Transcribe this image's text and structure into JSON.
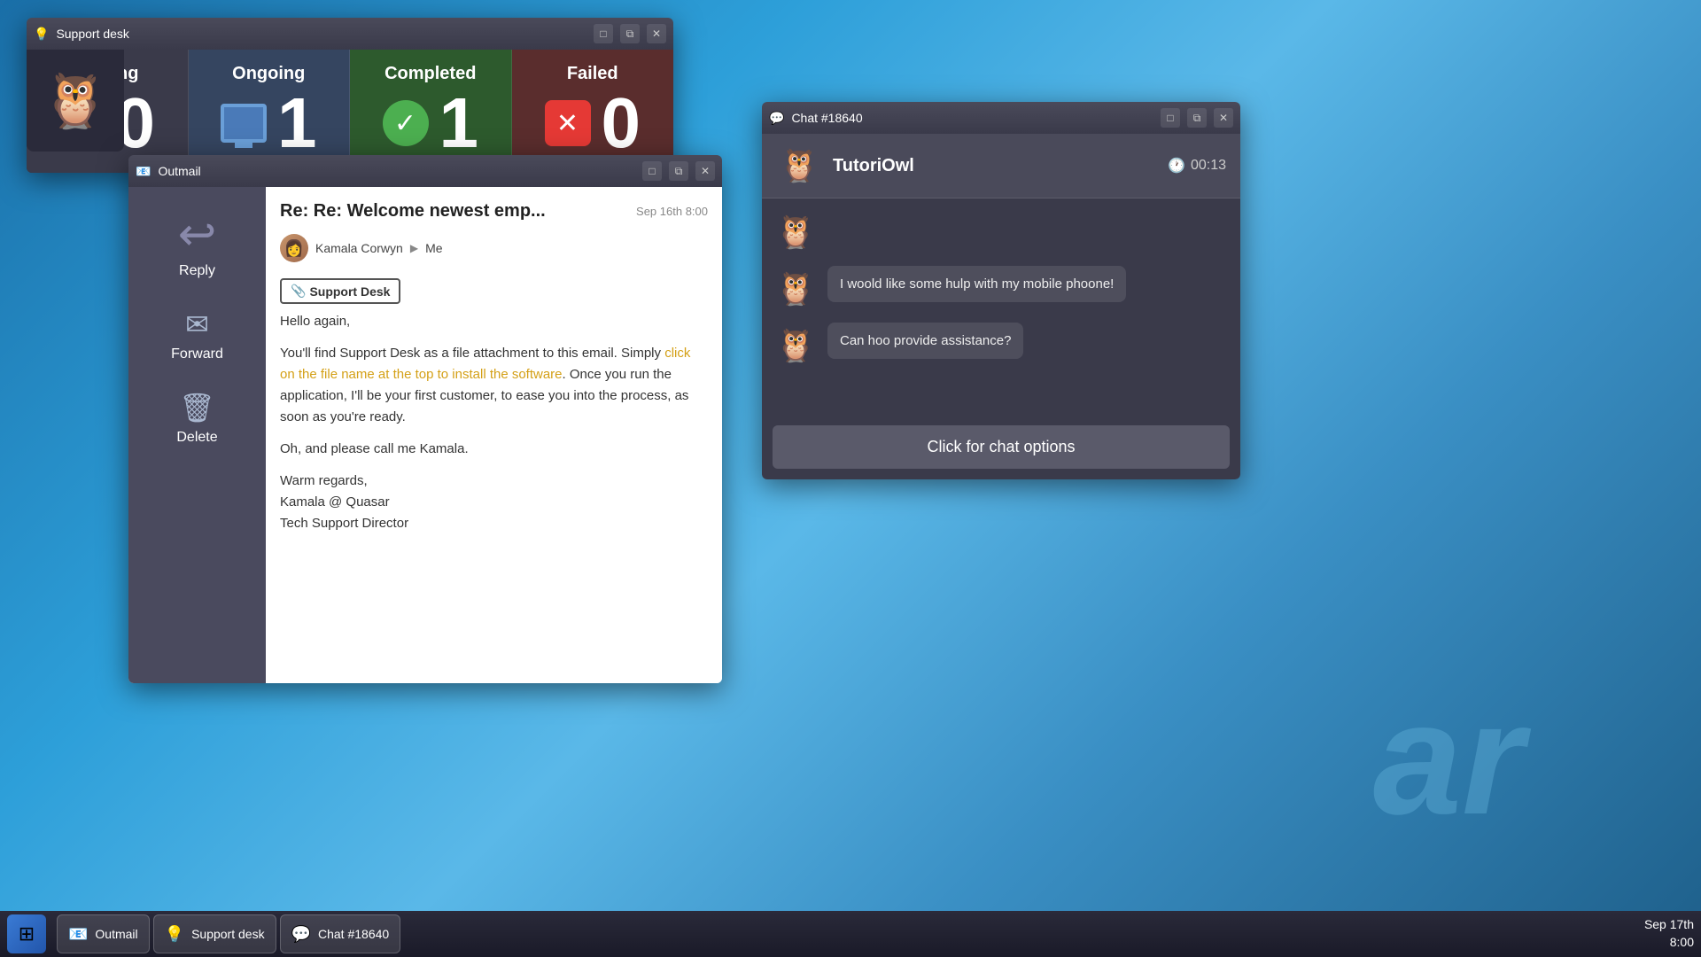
{
  "desktop": {
    "watermark": "ar"
  },
  "support_window": {
    "title": "Support desk",
    "icon": "💡",
    "stats": [
      {
        "label": "Waiting",
        "count": "0",
        "icon_type": "wifi",
        "bg": "waiting"
      },
      {
        "label": "Ongoing",
        "count": "1",
        "icon_type": "monitor",
        "bg": "ongoing"
      },
      {
        "label": "Completed",
        "count": "1",
        "icon_type": "check",
        "bg": "completed"
      },
      {
        "label": "Failed",
        "count": "0",
        "icon_type": "x",
        "bg": "failed"
      }
    ]
  },
  "outmail_window": {
    "title": "Outmail",
    "icon": "✉️",
    "actions": [
      {
        "label": "Reply",
        "icon": "↩"
      },
      {
        "label": "Forward",
        "icon": "✉"
      },
      {
        "label": "Delete",
        "icon": "🗑"
      }
    ],
    "email": {
      "subject": "Re: Re: Welcome newest emp...",
      "date": "Sep 16th 8:00",
      "from": "Kamala Corwyn",
      "to": "Me",
      "attachment": "Support Desk",
      "body_greeting": "Hello again,",
      "body_p1_normal_start": "You'll find Support Desk as a file attachment to this email. Simply ",
      "body_p1_highlight": "click on the file name at the top to install the software",
      "body_p1_normal_end": ". Once you run the application, I'll be your first customer, to ease you into the process, as soon as you're ready.",
      "body_p2": "Oh, and please call me Kamala.",
      "body_closing": "Warm regards,",
      "body_sig1": "Kamala @ Quasar",
      "body_sig2": "Tech Support Director"
    }
  },
  "chat_window": {
    "title": "Chat #18640",
    "icon": "💬",
    "username": "TutoriOwl",
    "timer": "00:13",
    "messages": [
      {
        "text": "I woold like some hulp with my mobile phoone!"
      },
      {
        "text": "Can hoo provide assistance?"
      }
    ],
    "options_button": "Click for chat options"
  },
  "taskbar": {
    "start_icon": "⊞",
    "items": [
      {
        "label": "Outmail",
        "icon": "📧"
      },
      {
        "label": "Support desk",
        "icon": "💡"
      },
      {
        "label": "Chat #18640",
        "icon": "💬"
      }
    ],
    "date": "Sep 17th",
    "time": "8:00"
  }
}
